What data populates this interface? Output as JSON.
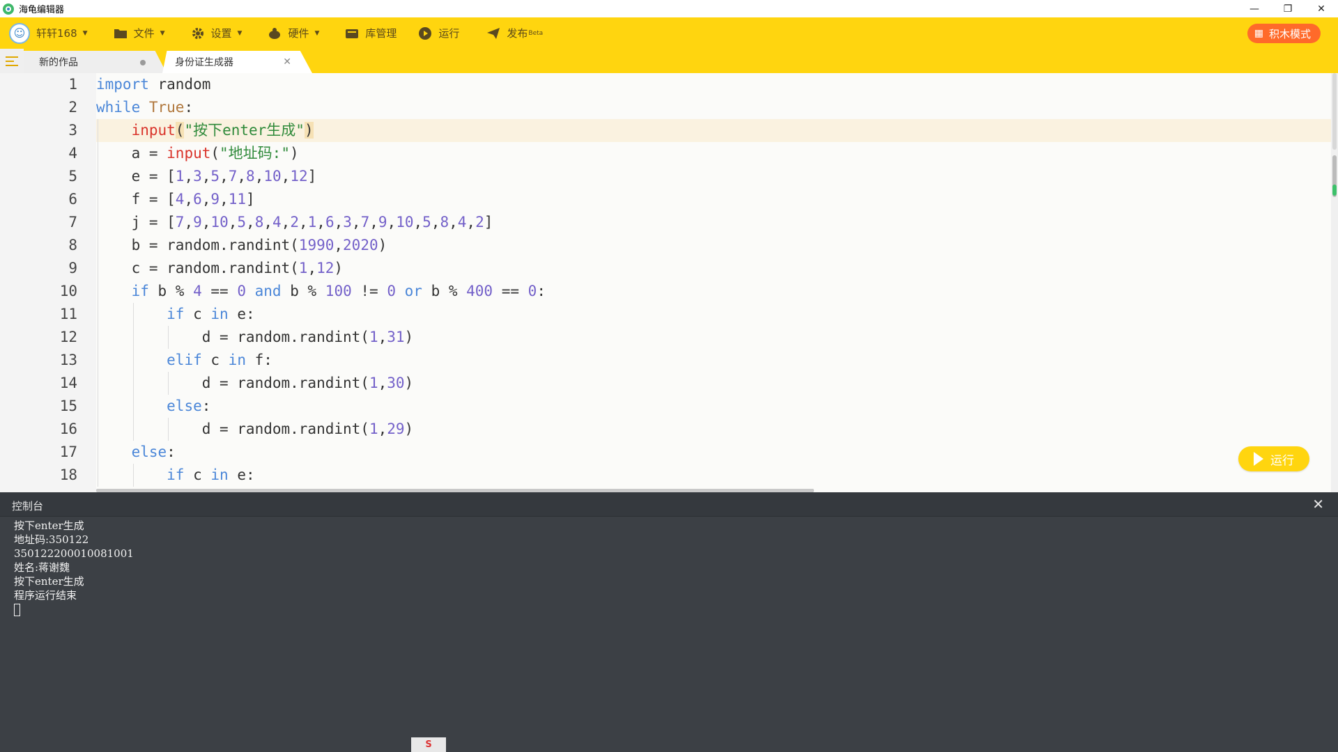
{
  "window": {
    "title": "海龟编辑器",
    "controls": [
      "—",
      "❐",
      "✕"
    ]
  },
  "toolbar": {
    "user_label": "轩轩168",
    "file_label": "文件",
    "settings_label": "设置",
    "hardware_label": "硬件",
    "library_label": "库管理",
    "run_label": "运行",
    "publish_label": "发布",
    "publish_badge": "Beta",
    "block_mode_label": "积木模式"
  },
  "tabs": [
    {
      "label": "新的作品"
    },
    {
      "label": "身份证生成器"
    }
  ],
  "editor": {
    "line_numbers": [
      "1",
      "2",
      "3",
      "4",
      "5",
      "6",
      "7",
      "8",
      "9",
      "10",
      "11",
      "12",
      "13",
      "14",
      "15",
      "16",
      "17",
      "18"
    ],
    "active_line": 3,
    "lines": [
      "import random",
      "while True:",
      "    input(\"按下enter生成\")",
      "    a = input(\"地址码:\")",
      "    e = [1,3,5,7,8,10,12]",
      "    f = [4,6,9,11]",
      "    j = [7,9,10,5,8,4,2,1,6,3,7,9,10,5,8,4,2]",
      "    b = random.randint(1990,2020)",
      "    c = random.randint(1,12)",
      "    if b % 4 == 0 and b % 100 != 0 or b % 400 == 0:",
      "        if c in e:",
      "            d = random.randint(1,31)",
      "        elif c in f:",
      "            d = random.randint(1,30)",
      "        else:",
      "            d = random.randint(1,29)",
      "    else:",
      "        if c in e:"
    ]
  },
  "run_button": {
    "label": "运行"
  },
  "console": {
    "title": "控制台",
    "output": [
      "按下enter生成",
      "地址码:350122",
      "350122200010081001",
      "姓名:蒋谢魏",
      "按下enter生成",
      "程序运行结束"
    ]
  },
  "ime": {
    "label": "S"
  },
  "colors": {
    "accent": "#ffd50f",
    "block_mode": "#ff6a2a",
    "console_bg": "#3c4045"
  }
}
